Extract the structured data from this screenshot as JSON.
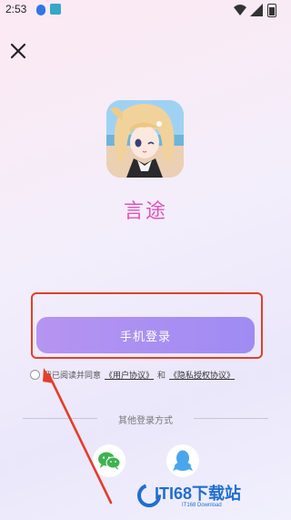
{
  "status_bar": {
    "time": "2:53",
    "icons": [
      "notification-dot-icon",
      "app-notification-icon",
      "wifi-icon",
      "signal-icon",
      "battery-icon"
    ]
  },
  "header": {
    "close_icon": "close-icon"
  },
  "app": {
    "name": "言途",
    "icon": "anime-girl-avatar"
  },
  "login": {
    "phone_login_label": "手机登录",
    "highlight_color": "#e43e2b",
    "button_color": "#a98ff2"
  },
  "agreement": {
    "prefix": "我已阅读并同意",
    "user_agreement": "《用户协议》",
    "and": "和",
    "privacy_agreement": "《隐私授权协议》"
  },
  "other_login": {
    "label": "其他登录方式",
    "options": [
      "wechat-icon",
      "qq-icon"
    ]
  },
  "watermark": {
    "title": "ITI68下载站",
    "subtitle": "IT168 Download"
  }
}
